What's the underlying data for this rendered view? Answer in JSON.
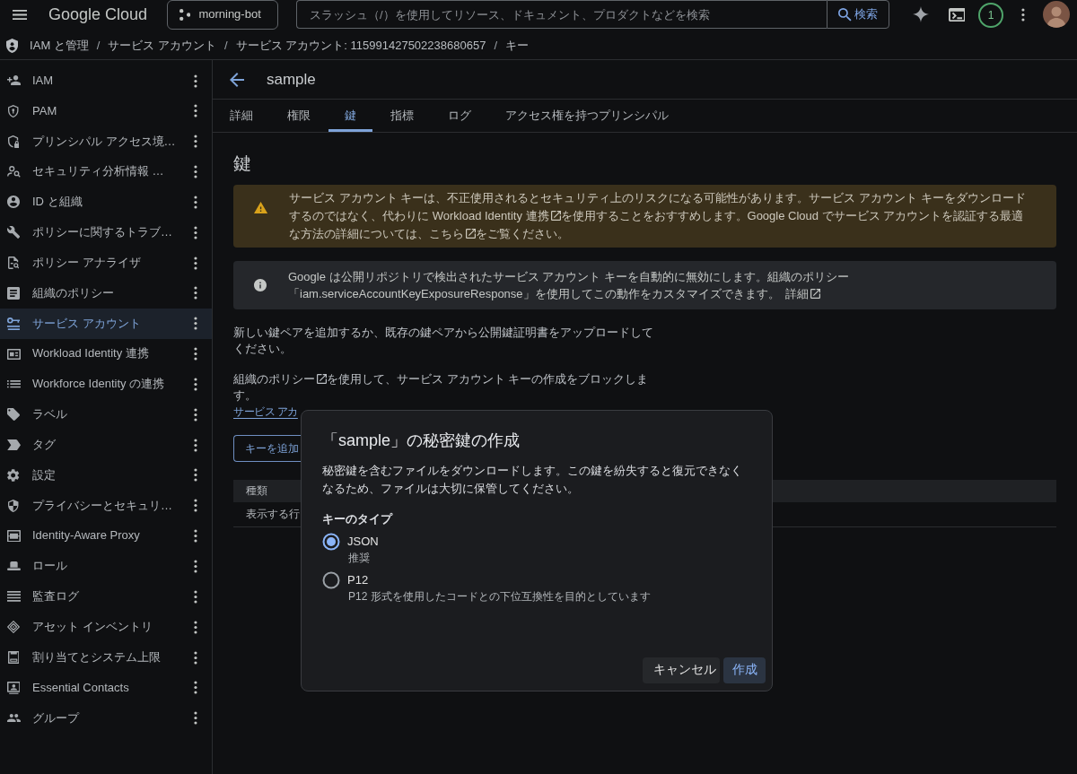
{
  "top_bar": {
    "logo": "Google Cloud",
    "project": "morning-bot",
    "search": {
      "placeholder": "スラッシュ（/）を使用してリソース、ドキュメント、プロダクトなどを検索"
    },
    "search_button": "検索",
    "notifications": "1"
  },
  "breadcrumb": [
    {
      "label": "IAM と管理",
      "separator": "/"
    },
    {
      "label": "サービス アカウント",
      "separator": "/"
    },
    {
      "label": "サービス アカウント: 115991427502238680657",
      "separator": "/"
    },
    {
      "label": "キー"
    }
  ],
  "sidebar": {
    "items": [
      {
        "label": "IAM",
        "selected": false
      },
      {
        "label": "PAM",
        "selected": false
      },
      {
        "label": "プリンシパル アクセス境…",
        "selected": false
      },
      {
        "label": "セキュリティ分析情報 …",
        "selected": false
      },
      {
        "label": "ID と組織",
        "selected": false
      },
      {
        "label": "ポリシーに関するトラブ…",
        "selected": false
      },
      {
        "label": "ポリシー アナライザ",
        "selected": false
      },
      {
        "label": "組織のポリシー",
        "selected": false
      },
      {
        "label": "サービス アカウント",
        "selected": true
      },
      {
        "label": "Workload Identity 連携",
        "selected": false
      },
      {
        "label": "Workforce Identity の連携",
        "selected": false
      },
      {
        "label": "ラベル",
        "selected": false
      },
      {
        "label": "タグ",
        "selected": false
      },
      {
        "label": "設定",
        "selected": false
      },
      {
        "label": "プライバシーとセキュリ…",
        "selected": false
      },
      {
        "label": "Identity-Aware Proxy",
        "selected": false
      },
      {
        "label": "ロール",
        "selected": false
      },
      {
        "label": "監査ログ",
        "selected": false
      },
      {
        "label": "アセット インベントリ",
        "selected": false
      },
      {
        "label": "割り当てとシステム上限",
        "selected": false
      },
      {
        "label": "Essential Contacts",
        "selected": false
      },
      {
        "label": "グループ",
        "selected": false
      }
    ]
  },
  "page": {
    "title": "sample",
    "tabs": [
      {
        "label": "詳細",
        "selected": false
      },
      {
        "label": "権限",
        "selected": false
      },
      {
        "label": "鍵",
        "selected": true
      },
      {
        "label": "指標",
        "selected": false
      },
      {
        "label": "ログ",
        "selected": false
      },
      {
        "label": "アクセス権を持つプリンシパル",
        "selected": false
      }
    ],
    "heading": "鍵",
    "warning": {
      "parts": [
        {
          "kind": "text",
          "text": "サービス アカウント キーは、不正使用されるとセキュリティ上のリスクになる可能性があります。サービス アカウント キーをダウンロードするのではなく、代わりに "
        },
        {
          "kind": "link",
          "text": "Workload Identity 連携"
        },
        {
          "kind": "text",
          "text": "を使用することをおすすめします。Google Cloud でサービス アカウントを認証する最適な方法の詳細については、"
        },
        {
          "kind": "link",
          "text": "こちら"
        },
        {
          "kind": "text",
          "text": "をご覧ください。"
        }
      ]
    },
    "info": {
      "parts": [
        {
          "kind": "text",
          "text": "Google は公開リポジトリで検出されたサービス アカウント キーを自動的に無効にします。組織のポリシー「iam.serviceAccountKeyExposureResponse」を使用してこの動作をカスタマイズできます。"
        },
        {
          "kind": "link",
          "text": "詳細"
        }
      ]
    },
    "intro": "新しい鍵ペアを追加するか、既存の鍵ペアから公開鍵証明書をアップロードしてください。",
    "policy_note": {
      "parts": [
        {
          "kind": "link",
          "text": "組織のポリシー"
        },
        {
          "kind": "text",
          "text": "を使用して、サービス アカウント キーの作成をブロックします。"
        }
      ]
    },
    "policy_link": "サービス アカ",
    "add_key_button": "キーを追加",
    "table": {
      "columns": [
        "種類"
      ],
      "empty_message": "表示する行"
    }
  },
  "dialog": {
    "title": "「sample」の秘密鍵の作成",
    "description": "秘密鍵を含むファイルをダウンロードします。この鍵を紛失すると復元できなくなるため、ファイルは大切に保管してください。",
    "field_label": "キーのタイプ",
    "options": [
      {
        "label": "JSON",
        "hint": "推奨",
        "selected": true
      },
      {
        "label": "P12",
        "hint": "P12 形式を使用したコードとの下位互換性を目的としています",
        "selected": false
      }
    ],
    "buttons": [
      {
        "label": "キャンセル",
        "kind": "secondary"
      },
      {
        "label": "作成",
        "kind": "primary"
      }
    ]
  }
}
